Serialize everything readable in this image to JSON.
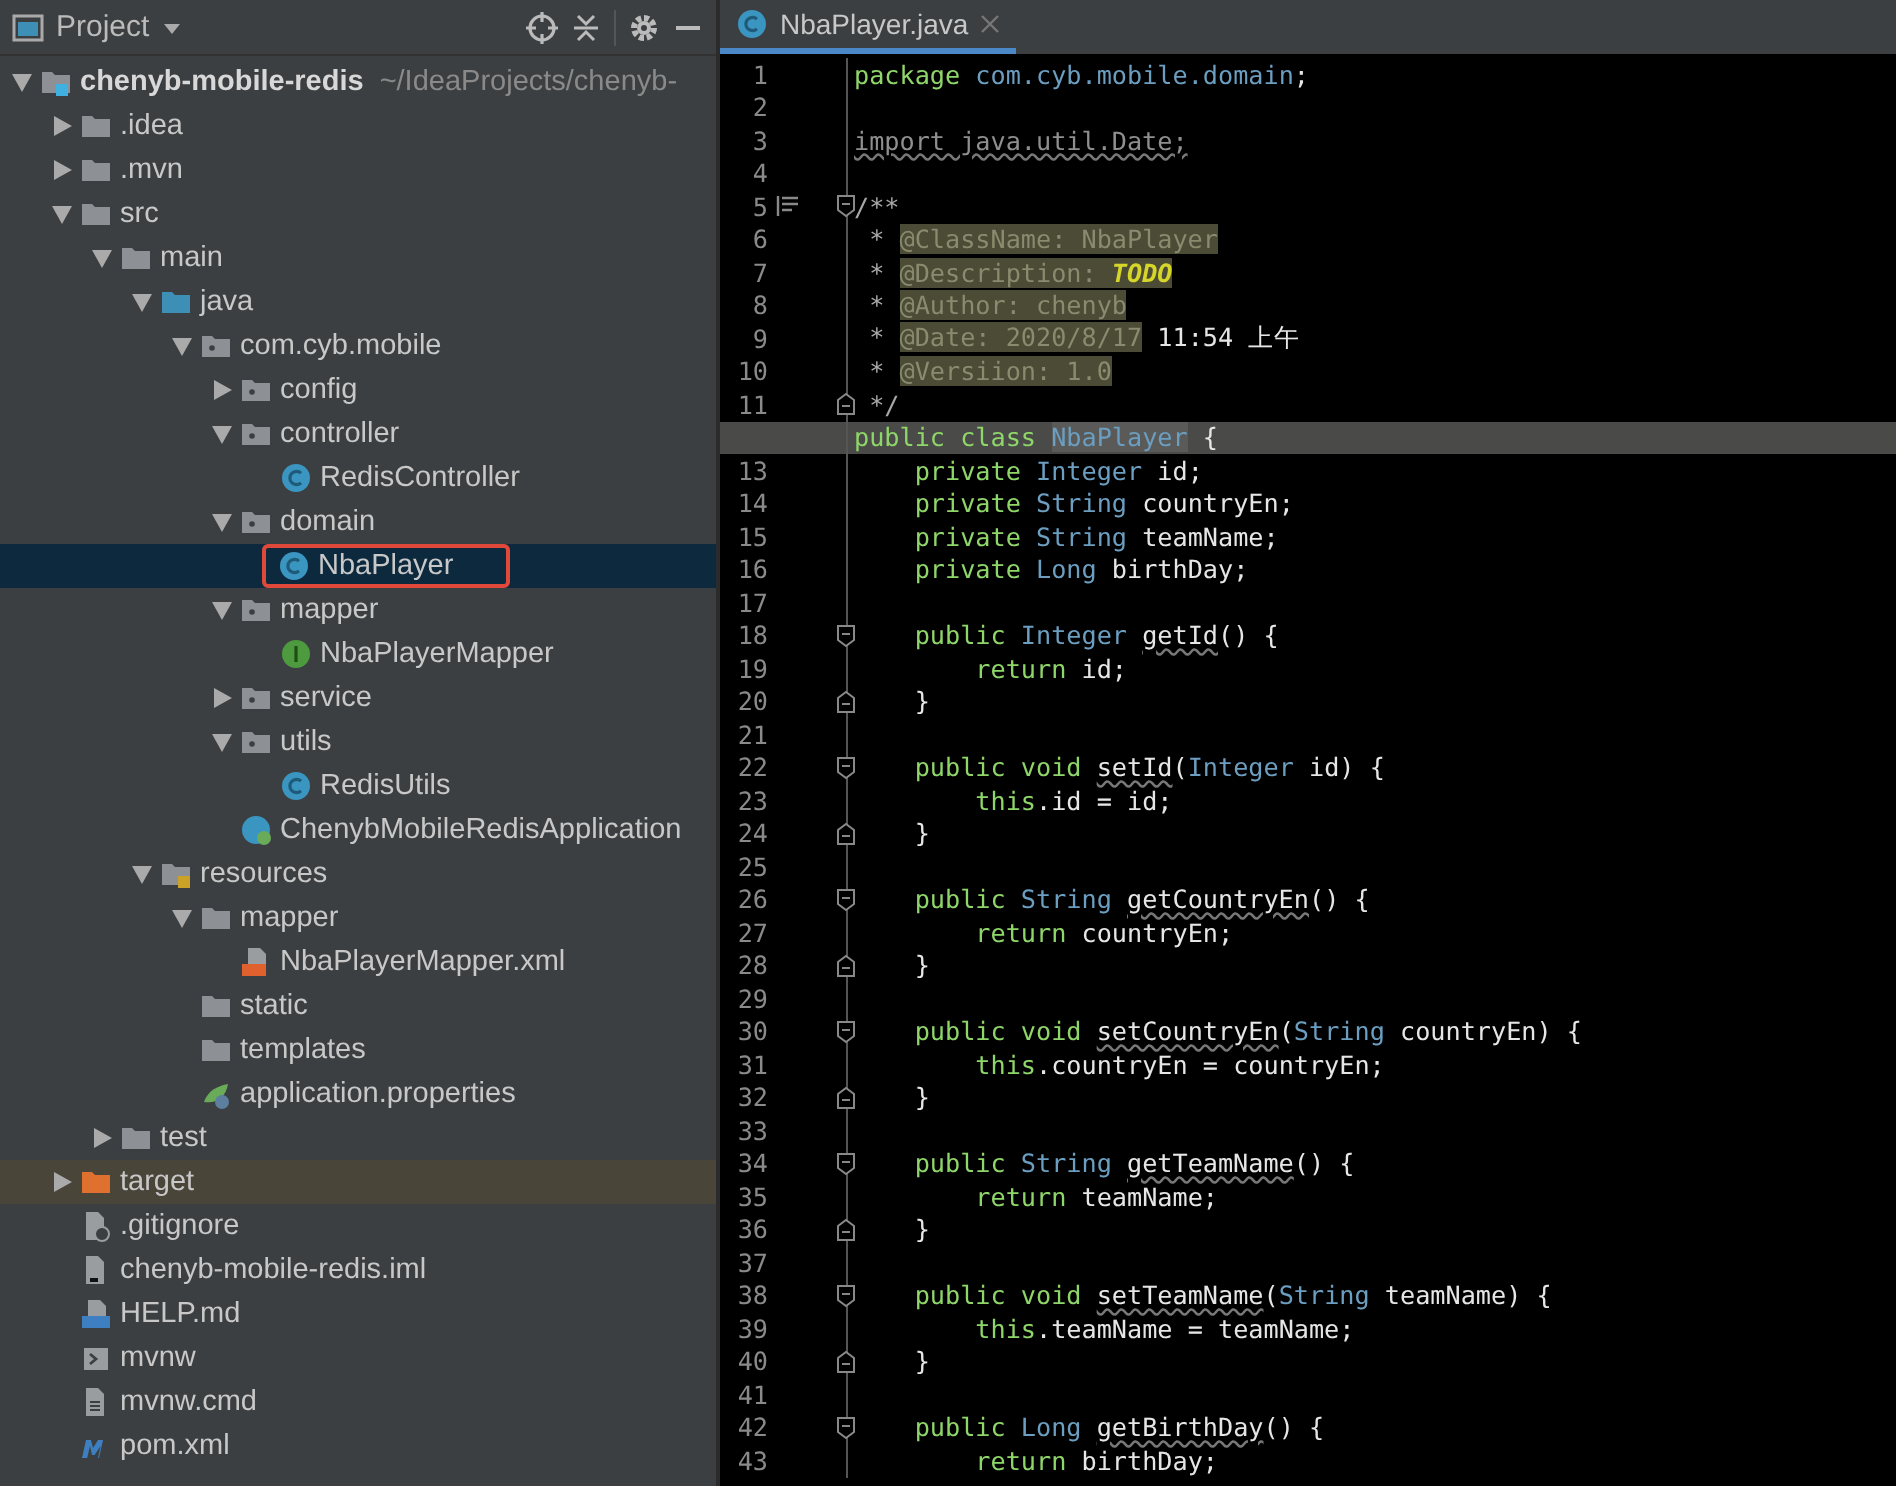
{
  "project_panel": {
    "title": "Project",
    "tree": [
      {
        "name": "chenyb-mobile-redis",
        "kind": "module",
        "path": "~/IdeaProjects/chenyb-",
        "selected": false,
        "expanded": true,
        "children": [
          {
            "name": ".idea",
            "kind": "folder",
            "selected": false,
            "expanded": false
          },
          {
            "name": ".mvn",
            "kind": "folder",
            "selected": false,
            "expanded": false
          },
          {
            "name": "src",
            "kind": "folder",
            "selected": false,
            "expanded": true,
            "children": [
              {
                "name": "main",
                "kind": "folder",
                "selected": false,
                "expanded": true,
                "children": [
                  {
                    "name": "java",
                    "kind": "source-root",
                    "selected": false,
                    "expanded": true,
                    "children": [
                      {
                        "name": "com.cyb.mobile",
                        "kind": "package",
                        "selected": false,
                        "expanded": true,
                        "children": [
                          {
                            "name": "config",
                            "kind": "package",
                            "selected": false,
                            "expanded": false
                          },
                          {
                            "name": "controller",
                            "kind": "package",
                            "selected": false,
                            "expanded": true,
                            "children": [
                              {
                                "name": "RedisController",
                                "kind": "class",
                                "selected": false
                              }
                            ]
                          },
                          {
                            "name": "domain",
                            "kind": "package",
                            "selected": false,
                            "expanded": true,
                            "children": [
                              {
                                "name": "NbaPlayer",
                                "kind": "class",
                                "selected": true,
                                "outlined": true
                              }
                            ]
                          },
                          {
                            "name": "mapper",
                            "kind": "package",
                            "selected": false,
                            "expanded": true,
                            "children": [
                              {
                                "name": "NbaPlayerMapper",
                                "kind": "interface",
                                "selected": false
                              }
                            ]
                          },
                          {
                            "name": "service",
                            "kind": "package",
                            "selected": false,
                            "expanded": false
                          },
                          {
                            "name": "utils",
                            "kind": "package",
                            "selected": false,
                            "expanded": true,
                            "children": [
                              {
                                "name": "RedisUtils",
                                "kind": "class",
                                "selected": false
                              }
                            ]
                          },
                          {
                            "name": "ChenybMobileRedisApplication",
                            "kind": "app-class",
                            "selected": false
                          }
                        ]
                      }
                    ]
                  },
                  {
                    "name": "resources",
                    "kind": "resources-root",
                    "selected": false,
                    "expanded": true,
                    "children": [
                      {
                        "name": "mapper",
                        "kind": "folder",
                        "selected": false,
                        "expanded": true,
                        "children": [
                          {
                            "name": "NbaPlayerMapper.xml",
                            "kind": "xml",
                            "selected": false
                          }
                        ]
                      },
                      {
                        "name": "static",
                        "kind": "folder",
                        "selected": false
                      },
                      {
                        "name": "templates",
                        "kind": "folder",
                        "selected": false
                      },
                      {
                        "name": "application.properties",
                        "kind": "properties",
                        "selected": false
                      }
                    ]
                  }
                ]
              },
              {
                "name": "test",
                "kind": "folder",
                "selected": false,
                "expanded": false
              }
            ]
          },
          {
            "name": "target",
            "kind": "excluded",
            "selected": false,
            "excluded": true,
            "expanded": false
          },
          {
            "name": ".gitignore",
            "kind": "ignore-file",
            "selected": false
          },
          {
            "name": "chenyb-mobile-redis.iml",
            "kind": "iml-file",
            "selected": false
          },
          {
            "name": "HELP.md",
            "kind": "md-file",
            "selected": false
          },
          {
            "name": "mvnw",
            "kind": "script-file",
            "selected": false
          },
          {
            "name": "mvnw.cmd",
            "kind": "text-file",
            "selected": false
          },
          {
            "name": "pom.xml",
            "kind": "maven",
            "selected": false
          }
        ]
      }
    ]
  },
  "editor": {
    "tabs": [
      {
        "label": "NbaPlayer.java",
        "selected": true
      }
    ],
    "lines": [
      {
        "number": "1",
        "tokens": [
          {
            "kind": "kw",
            "text": "package "
          },
          {
            "kind": "pkg",
            "text": "com.cyb.mobile.domain"
          },
          {
            "kind": "plain",
            "text": ";"
          }
        ]
      },
      {
        "number": "2"
      },
      {
        "number": "3",
        "tokens": [
          {
            "kind": "unused",
            "text": "import java.util.Date;"
          }
        ]
      },
      {
        "number": "4"
      },
      {
        "number": "5",
        "fold_start": true,
        "doc_marker": true,
        "tokens": [
          {
            "kind": "comment",
            "text": "/**"
          }
        ]
      },
      {
        "number": "6",
        "tokens": [
          {
            "kind": "comment",
            "text": " * "
          },
          {
            "kind": "doctag",
            "text": "@ClassName: NbaPlayer"
          }
        ]
      },
      {
        "number": "7",
        "tokens": [
          {
            "kind": "comment",
            "text": " * "
          },
          {
            "kind": "doctag",
            "text": "@Description: "
          },
          {
            "kind": "todo",
            "text": "TODO"
          }
        ]
      },
      {
        "number": "8",
        "tokens": [
          {
            "kind": "comment",
            "text": " * "
          },
          {
            "kind": "doctag",
            "text": "@Author: chenyb"
          }
        ]
      },
      {
        "number": "9",
        "tokens": [
          {
            "kind": "comment",
            "text": " * "
          },
          {
            "kind": "doctag",
            "text": "@Date: 2020/8/17"
          },
          {
            "kind": "plain",
            "text": " 11:54 上午"
          }
        ]
      },
      {
        "number": "10",
        "tokens": [
          {
            "kind": "comment",
            "text": " * "
          },
          {
            "kind": "doctag",
            "text": "@Versiion: 1.0"
          }
        ]
      },
      {
        "number": "11",
        "fold_end": true,
        "tokens": [
          {
            "kind": "comment",
            "text": " */"
          }
        ]
      },
      {
        "current": true,
        "tokens": [
          {
            "kind": "kw",
            "text": "public class "
          },
          {
            "kind": "ident",
            "text": "NbaPlayer"
          },
          {
            "kind": "plain",
            "text": " {"
          }
        ]
      },
      {
        "number": "13",
        "tokens": [
          {
            "kind": "kw",
            "text": "    private "
          },
          {
            "kind": "type",
            "text": "Integer"
          },
          {
            "kind": "plain",
            "text": " id;"
          }
        ]
      },
      {
        "number": "14",
        "tokens": [
          {
            "kind": "kw",
            "text": "    private "
          },
          {
            "kind": "type",
            "text": "String"
          },
          {
            "kind": "plain",
            "text": " countryEn;"
          }
        ]
      },
      {
        "number": "15",
        "tokens": [
          {
            "kind": "kw",
            "text": "    private "
          },
          {
            "kind": "type",
            "text": "String"
          },
          {
            "kind": "plain",
            "text": " teamName;"
          }
        ]
      },
      {
        "number": "16",
        "tokens": [
          {
            "kind": "kw",
            "text": "    private "
          },
          {
            "kind": "type",
            "text": "Long"
          },
          {
            "kind": "plain",
            "text": " birthDay;"
          }
        ]
      },
      {
        "number": "17"
      },
      {
        "number": "18",
        "fold_start": true,
        "tokens": [
          {
            "kind": "kw",
            "text": "    public "
          },
          {
            "kind": "type",
            "text": "Integer "
          },
          {
            "kind": "method",
            "text": "getId"
          },
          {
            "kind": "plain",
            "text": "() {"
          }
        ]
      },
      {
        "number": "19",
        "tokens": [
          {
            "kind": "kw",
            "text": "        return"
          },
          {
            "kind": "plain",
            "text": " id;"
          }
        ]
      },
      {
        "number": "20",
        "fold_end": true,
        "tokens": [
          {
            "kind": "plain",
            "text": "    }"
          }
        ]
      },
      {
        "number": "21"
      },
      {
        "number": "22",
        "fold_start": true,
        "tokens": [
          {
            "kind": "kw",
            "text": "    public void "
          },
          {
            "kind": "method",
            "text": "setId"
          },
          {
            "kind": "plain",
            "text": "("
          },
          {
            "kind": "type",
            "text": "Integer"
          },
          {
            "kind": "plain",
            "text": " id) {"
          }
        ]
      },
      {
        "number": "23",
        "tokens": [
          {
            "kind": "kw",
            "text": "        this"
          },
          {
            "kind": "plain",
            "text": ".id = id;"
          }
        ]
      },
      {
        "number": "24",
        "fold_end": true,
        "tokens": [
          {
            "kind": "plain",
            "text": "    }"
          }
        ]
      },
      {
        "number": "25"
      },
      {
        "number": "26",
        "fold_start": true,
        "tokens": [
          {
            "kind": "kw",
            "text": "    public "
          },
          {
            "kind": "type",
            "text": "String "
          },
          {
            "kind": "method",
            "text": "getCountryEn"
          },
          {
            "kind": "plain",
            "text": "() {"
          }
        ]
      },
      {
        "number": "27",
        "tokens": [
          {
            "kind": "kw",
            "text": "        return"
          },
          {
            "kind": "plain",
            "text": " countryEn;"
          }
        ]
      },
      {
        "number": "28",
        "fold_end": true,
        "tokens": [
          {
            "kind": "plain",
            "text": "    }"
          }
        ]
      },
      {
        "number": "29"
      },
      {
        "number": "30",
        "fold_start": true,
        "tokens": [
          {
            "kind": "kw",
            "text": "    public void "
          },
          {
            "kind": "method",
            "text": "setCountryEn"
          },
          {
            "kind": "plain",
            "text": "("
          },
          {
            "kind": "type",
            "text": "String"
          },
          {
            "kind": "plain",
            "text": " countryEn) {"
          }
        ]
      },
      {
        "number": "31",
        "tokens": [
          {
            "kind": "kw",
            "text": "        this"
          },
          {
            "kind": "plain",
            "text": ".countryEn = countryEn;"
          }
        ]
      },
      {
        "number": "32",
        "fold_end": true,
        "tokens": [
          {
            "kind": "plain",
            "text": "    }"
          }
        ]
      },
      {
        "number": "33"
      },
      {
        "number": "34",
        "fold_start": true,
        "tokens": [
          {
            "kind": "kw",
            "text": "    public "
          },
          {
            "kind": "type",
            "text": "String "
          },
          {
            "kind": "method",
            "text": "getTeamName"
          },
          {
            "kind": "plain",
            "text": "() {"
          }
        ]
      },
      {
        "number": "35",
        "tokens": [
          {
            "kind": "kw",
            "text": "        return"
          },
          {
            "kind": "plain",
            "text": " teamName;"
          }
        ]
      },
      {
        "number": "36",
        "fold_end": true,
        "tokens": [
          {
            "kind": "plain",
            "text": "    }"
          }
        ]
      },
      {
        "number": "37"
      },
      {
        "number": "38",
        "fold_start": true,
        "tokens": [
          {
            "kind": "kw",
            "text": "    public void "
          },
          {
            "kind": "method",
            "text": "setTeamName"
          },
          {
            "kind": "plain",
            "text": "("
          },
          {
            "kind": "type",
            "text": "String"
          },
          {
            "kind": "plain",
            "text": " teamName) {"
          }
        ]
      },
      {
        "number": "39",
        "tokens": [
          {
            "kind": "kw",
            "text": "        this"
          },
          {
            "kind": "plain",
            "text": ".teamName = teamName;"
          }
        ]
      },
      {
        "number": "40",
        "fold_end": true,
        "tokens": [
          {
            "kind": "plain",
            "text": "    }"
          }
        ]
      },
      {
        "number": "41"
      },
      {
        "number": "42",
        "fold_start": true,
        "tokens": [
          {
            "kind": "kw",
            "text": "    public "
          },
          {
            "kind": "type",
            "text": "Long "
          },
          {
            "kind": "method",
            "text": "getBirthDay"
          },
          {
            "kind": "plain",
            "text": "() {"
          }
        ]
      },
      {
        "number": "43",
        "tokens": [
          {
            "kind": "kw",
            "text": "        return"
          },
          {
            "kind": "plain",
            "text": " birthDay;"
          }
        ]
      }
    ]
  }
}
